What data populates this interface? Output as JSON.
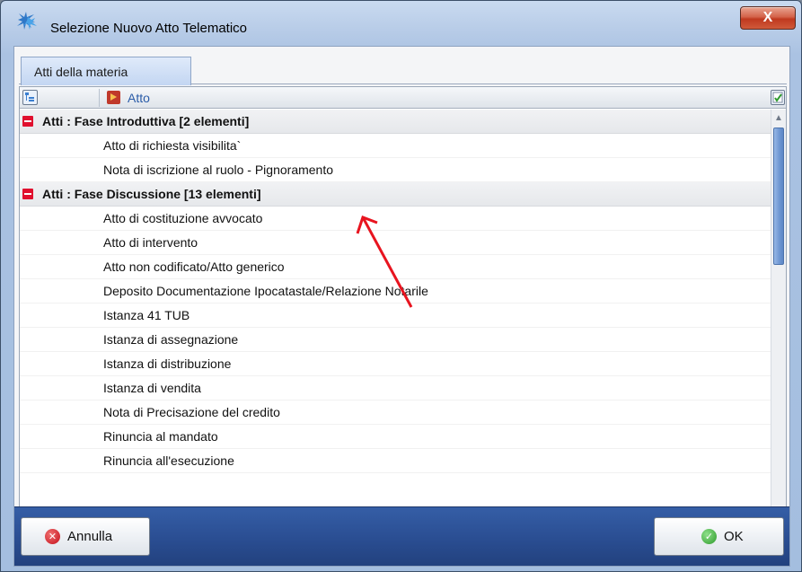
{
  "window": {
    "title": "Selezione Nuovo Atto Telematico",
    "close_label": "X"
  },
  "tabs": [
    {
      "label": "Atti della materia",
      "active": true
    }
  ],
  "grid": {
    "column_header": "Atto",
    "groups": [
      {
        "label": "Atti : Fase Introduttiva  [2 elementi]",
        "items": [
          "Atto di richiesta visibilita`",
          "Nota di iscrizione al ruolo - Pignoramento"
        ]
      },
      {
        "label": "Atti : Fase Discussione  [13 elementi]",
        "items": [
          "Atto di costituzione avvocato",
          "Atto di intervento",
          "Atto non codificato/Atto generico",
          "Deposito Documentazione Ipocatastale/Relazione Notarile",
          "Istanza 41 TUB",
          "Istanza di assegnazione",
          "Istanza di distribuzione",
          "Istanza di vendita",
          "Nota di Precisazione del credito",
          "Rinuncia al mandato",
          "Rinuncia all'esecuzione"
        ]
      }
    ]
  },
  "footer": {
    "cancel_label": "Annulla",
    "ok_label": "OK"
  },
  "colors": {
    "footer_blue": "#2b4f94",
    "group_minus_red": "#e0102e",
    "annotation_arrow": "#e8141f"
  }
}
